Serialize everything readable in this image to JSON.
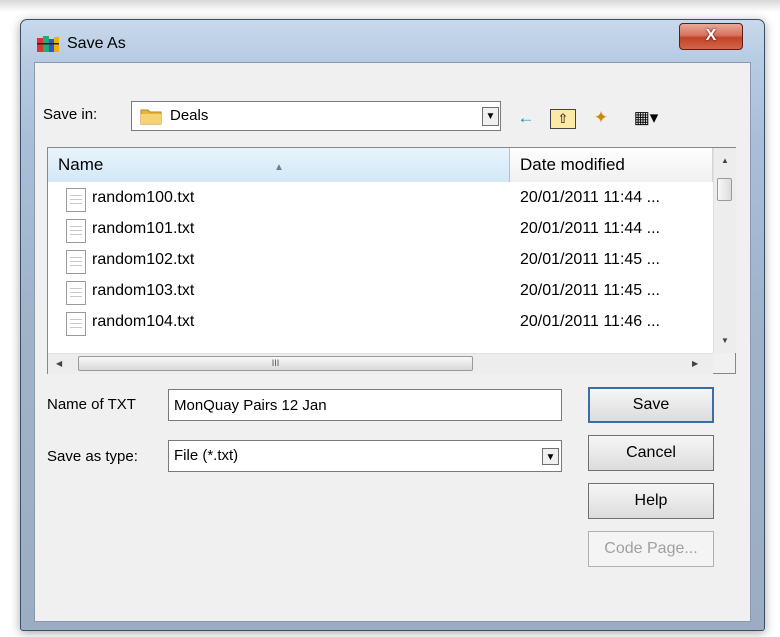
{
  "window": {
    "title": "Save As",
    "close_label": "X"
  },
  "toolbar": {
    "save_in_label": "Save in:",
    "save_in_value": "Deals",
    "dropdown_glyph": "▼",
    "back_icon": "←",
    "up_icon": "⇧",
    "new_folder_icon": "✦",
    "view_menu_icon": "▦▾"
  },
  "list": {
    "columns": {
      "name": "Name",
      "date": "Date modified"
    },
    "files": [
      {
        "name": "random100.txt",
        "date": "20/01/2011 11:44 ..."
      },
      {
        "name": "random101.txt",
        "date": "20/01/2011 11:44 ..."
      },
      {
        "name": "random102.txt",
        "date": "20/01/2011 11:45 ..."
      },
      {
        "name": "random103.txt",
        "date": "20/01/2011 11:45 ..."
      },
      {
        "name": "random104.txt",
        "date": "20/01/2011 11:46 ..."
      }
    ],
    "hscroll_grip": "III"
  },
  "form": {
    "filename_label": "Name of TXT",
    "filename_value": "MonQuay Pairs 12 Jan",
    "type_label": "Save as type:",
    "type_value": "File (*.txt)"
  },
  "buttons": {
    "save": "Save",
    "cancel": "Cancel",
    "help": "Help",
    "code_page": "Code Page..."
  },
  "colors": {
    "title_accent": "#c24328",
    "header_highlight": "#d2e8f8",
    "default_button_border": "#3a6ea5"
  }
}
